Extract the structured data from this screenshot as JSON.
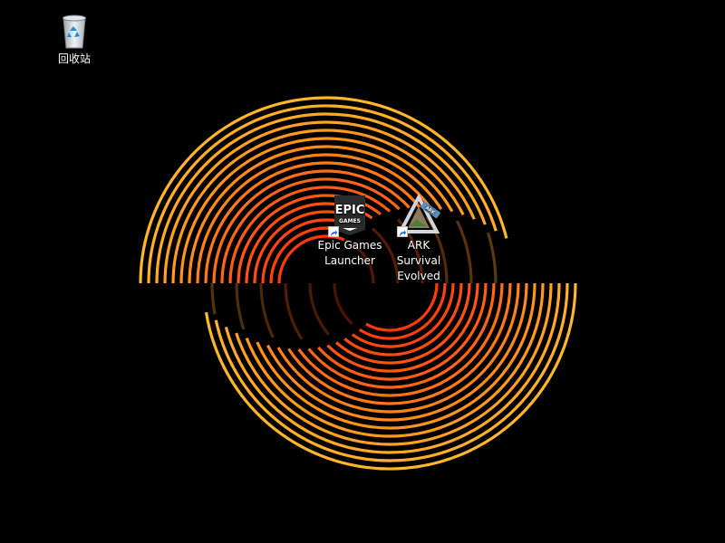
{
  "desktop": {
    "wallpaper": {
      "style": "orange-concentric-split-rings",
      "colors": [
        "#ffb72a",
        "#ff8e1a",
        "#ff5a12",
        "#ff3a0a"
      ]
    },
    "icons": [
      {
        "id": "recycle-bin",
        "label": "回收站",
        "icon": "recycle-bin-icon"
      },
      {
        "id": "epic-games-launcher",
        "label": "Epic Games\nLauncher",
        "icon": "epic-games-logo",
        "logo_text": "EPIC",
        "logo_subtext": "GAMES",
        "shortcut": true
      },
      {
        "id": "ark-survival-evolved",
        "label": "ARK Survival\nEvolved",
        "icon": "ark-logo",
        "logo_text": "ARK",
        "shortcut": true
      }
    ]
  }
}
